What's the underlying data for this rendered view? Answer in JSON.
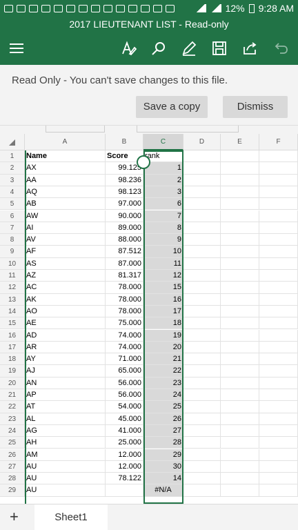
{
  "status_bar": {
    "icons": [
      "more-icon",
      "mail-icon",
      "mail-icon",
      "mail-icon",
      "mail-icon",
      "chat-icon",
      "mail-icon",
      "mail-icon",
      "whatsapp-icon",
      "dd-icon",
      "dd-icon",
      "download-icon",
      "settings-icon",
      "paypal-icon"
    ],
    "battery": "12%",
    "time": "9:28 AM"
  },
  "title_bar": {
    "title": "2017 LIEUTENANT LIST - Read-only"
  },
  "toolbar": {
    "icons": [
      "menu-icon",
      "draw-icon",
      "search-icon",
      "pen-icon",
      "save-icon",
      "share-icon",
      "undo-icon"
    ]
  },
  "banner": {
    "message": "Read Only - You can't save changes to this file.",
    "save_copy_label": "Save a copy",
    "dismiss_label": "Dismiss"
  },
  "sheet": {
    "columns": [
      "A",
      "B",
      "C",
      "D",
      "E",
      "F"
    ],
    "headers": {
      "name": "Name",
      "score": "Score",
      "rank": "rank"
    },
    "rows": [
      {
        "row": "1",
        "name": "Name",
        "score": "Score",
        "rank": "rank"
      },
      {
        "row": "2",
        "name": "AX",
        "score": "99.125",
        "rank": "1"
      },
      {
        "row": "3",
        "name": "AA",
        "score": "98.236",
        "rank": "2"
      },
      {
        "row": "4",
        "name": "AQ",
        "score": "98.123",
        "rank": "3"
      },
      {
        "row": "5",
        "name": "AB",
        "score": "97.000",
        "rank": "6"
      },
      {
        "row": "6",
        "name": "AW",
        "score": "90.000",
        "rank": "7"
      },
      {
        "row": "7",
        "name": "AI",
        "score": "89.000",
        "rank": "8"
      },
      {
        "row": "8",
        "name": "AV",
        "score": "88.000",
        "rank": "9"
      },
      {
        "row": "9",
        "name": "AF",
        "score": "87.512",
        "rank": "10"
      },
      {
        "row": "10",
        "name": "AS",
        "score": "87.000",
        "rank": "11"
      },
      {
        "row": "11",
        "name": "AZ",
        "score": "81.317",
        "rank": "12"
      },
      {
        "row": "12",
        "name": "AC",
        "score": "78.000",
        "rank": "15"
      },
      {
        "row": "13",
        "name": "AK",
        "score": "78.000",
        "rank": "16"
      },
      {
        "row": "14",
        "name": "AO",
        "score": "78.000",
        "rank": "17"
      },
      {
        "row": "15",
        "name": "AE",
        "score": "75.000",
        "rank": "18"
      },
      {
        "row": "16",
        "name": "AD",
        "score": "74.000",
        "rank": "19"
      },
      {
        "row": "17",
        "name": "AR",
        "score": "74.000",
        "rank": "20"
      },
      {
        "row": "18",
        "name": "AY",
        "score": "71.000",
        "rank": "21"
      },
      {
        "row": "19",
        "name": "AJ",
        "score": "65.000",
        "rank": "22"
      },
      {
        "row": "20",
        "name": "AN",
        "score": "56.000",
        "rank": "23"
      },
      {
        "row": "21",
        "name": "AP",
        "score": "56.000",
        "rank": "24"
      },
      {
        "row": "22",
        "name": "AT",
        "score": "54.000",
        "rank": "25"
      },
      {
        "row": "23",
        "name": "AL",
        "score": "45.000",
        "rank": "26"
      },
      {
        "row": "24",
        "name": "AG",
        "score": "41.000",
        "rank": "27"
      },
      {
        "row": "25",
        "name": "AH",
        "score": "25.000",
        "rank": "28"
      },
      {
        "row": "26",
        "name": "AM",
        "score": "12.000",
        "rank": "29"
      },
      {
        "row": "27",
        "name": "AU",
        "score": "12.000",
        "rank": "30"
      },
      {
        "row": "28",
        "name": "AU",
        "score": "78.122",
        "rank": "14"
      },
      {
        "row": "29",
        "name": "AU",
        "score": "",
        "rank": "#N/A"
      }
    ]
  },
  "tabs": {
    "add_label": "+",
    "sheet_name": "Sheet1"
  },
  "colors": {
    "accent": "#217346",
    "banner_bg": "#f3f3f3",
    "button_bg": "#d9d9d9"
  }
}
